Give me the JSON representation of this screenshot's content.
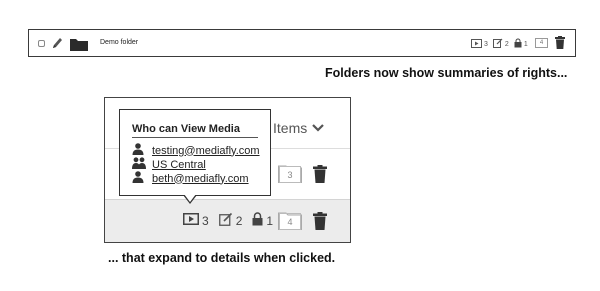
{
  "folder_row": {
    "name": "Demo folder",
    "rights": {
      "media_count": "3",
      "edit_count": "2",
      "lock_count": "1"
    },
    "item_count": "4"
  },
  "caption_top": "Folders now show summaries of rights...",
  "caption_bottom": "... that expand to details when clicked.",
  "zoom_panel": {
    "header_label": "Items",
    "row1_count": "3",
    "row2_count": "4",
    "rights": {
      "media_count": "3",
      "edit_count": "2",
      "lock_count": "1"
    }
  },
  "popover": {
    "title": "Who can View Media",
    "entries": [
      {
        "label": "testing@mediafly.com",
        "icon": "user-icon"
      },
      {
        "label": "US Central",
        "icon": "group-icon"
      },
      {
        "label": "beth@mediafly.com",
        "icon": "user-icon"
      }
    ]
  }
}
